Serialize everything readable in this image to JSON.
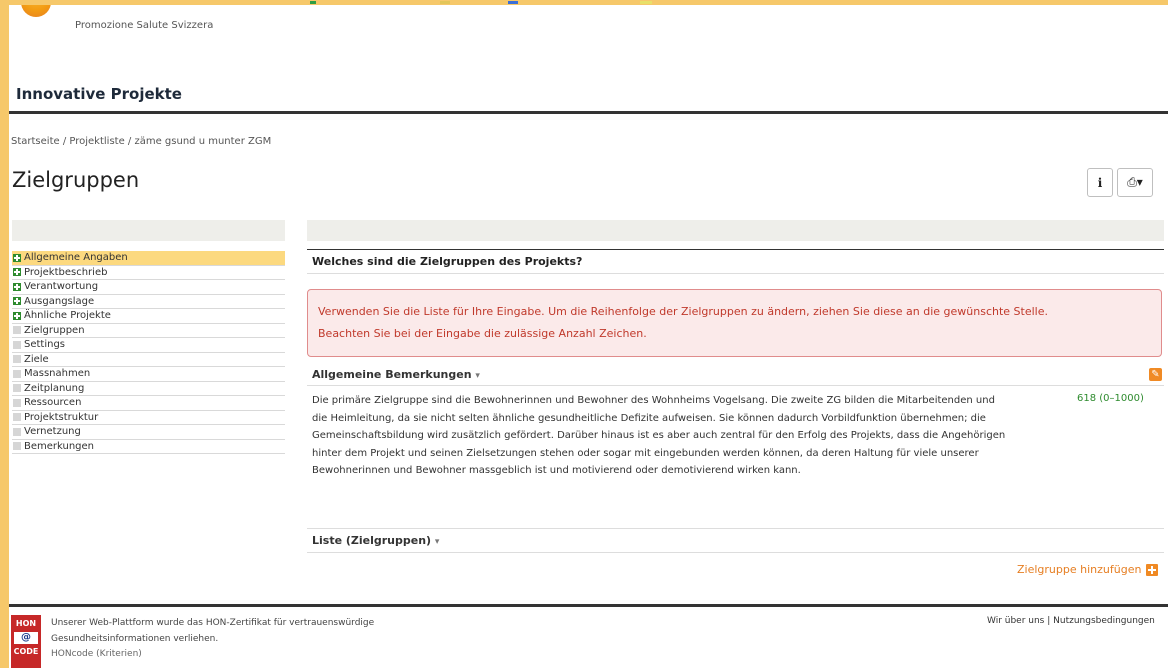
{
  "brand": {
    "org_name": "Promozione Salute Svizzera"
  },
  "app": {
    "title": "Innovative Projekte"
  },
  "breadcrumb": {
    "home": "Startseite",
    "list": "Projektliste",
    "current": "zäme gsund u munter ZGM",
    "separator": " / "
  },
  "page": {
    "title": "Zielgruppen"
  },
  "toolbar": {
    "info_icon": "i",
    "print_icon": "⎙▾"
  },
  "sidebar": {
    "items": [
      {
        "label": "Allgemeine Angaben",
        "done": true,
        "active": true
      },
      {
        "label": "Projektbeschrieb",
        "done": true
      },
      {
        "label": "Verantwortung",
        "done": true
      },
      {
        "label": "Ausgangslage",
        "done": true
      },
      {
        "label": "Ähnliche Projekte",
        "done": true
      },
      {
        "label": "Zielgruppen",
        "done": false
      },
      {
        "label": "Settings",
        "done": false
      },
      {
        "label": "Ziele",
        "done": false
      },
      {
        "label": "Massnahmen",
        "done": false
      },
      {
        "label": "Zeitplanung",
        "done": false
      },
      {
        "label": "Ressourcen",
        "done": false
      },
      {
        "label": "Projektstruktur",
        "done": false
      },
      {
        "label": "Vernetzung",
        "done": false
      },
      {
        "label": "Bemerkungen",
        "done": false
      }
    ]
  },
  "main": {
    "question": "Welches sind die Zielgruppen des Projekts?",
    "alert": {
      "line1": "Verwenden Sie die Liste für Ihre Eingabe. Um die Reihenfolge der Zielgruppen zu ändern, ziehen Sie diese an die gewünschte Stelle.",
      "line2": "Beachten Sie bei der Eingabe die zulässige Anzahl Zeichen."
    },
    "remarks": {
      "title": "Allgemeine Bemerkungen",
      "text": "Die primäre Zielgruppe sind die Bewohnerinnen und Bewohner des Wohnheims Vogelsang. Die zweite ZG bilden die Mitarbeitenden und die Heimleitung, da sie nicht selten ähnliche gesundheitliche Defizite aufweisen. Sie können dadurch Vorbildfunktion übernehmen; die Gemeinschaftsbildung wird zusätzlich gefördert. Darüber hinaus ist es aber auch zentral für den Erfolg des Projekts, dass die Angehörigen hinter dem Projekt und seinen Zielsetzungen stehen oder sogar mit eingebunden werden können, da deren Haltung für viele unserer Bewohnerinnen und Bewohner massgeblich ist und motivierend oder demotivierend wirken kann.",
      "counter": "618 (0–1000)"
    },
    "list": {
      "title": "Liste (Zielgruppen)"
    },
    "add_label": "Zielgruppe hinzufügen",
    "caret": "▾"
  },
  "footer": {
    "hon_top": "HON",
    "hon_mid": "@",
    "hon_bottom": "CODE",
    "cert_line1": "Unserer Web-Plattform wurde das HON-Zertifikat für vertrauenswürdige",
    "cert_line2": "Gesundheitsinformationen verliehen.",
    "honcode_link": "HONcode (Kriterien)",
    "about": "Wir über uns",
    "separator": " | ",
    "terms": "Nutzungsbedingungen"
  },
  "colors": {
    "accent": "#f08a24",
    "active_bg": "#fcd97f",
    "done_green": "#2e8b2e",
    "alert_red": "#c0392b",
    "frame": "#f6c86a"
  }
}
